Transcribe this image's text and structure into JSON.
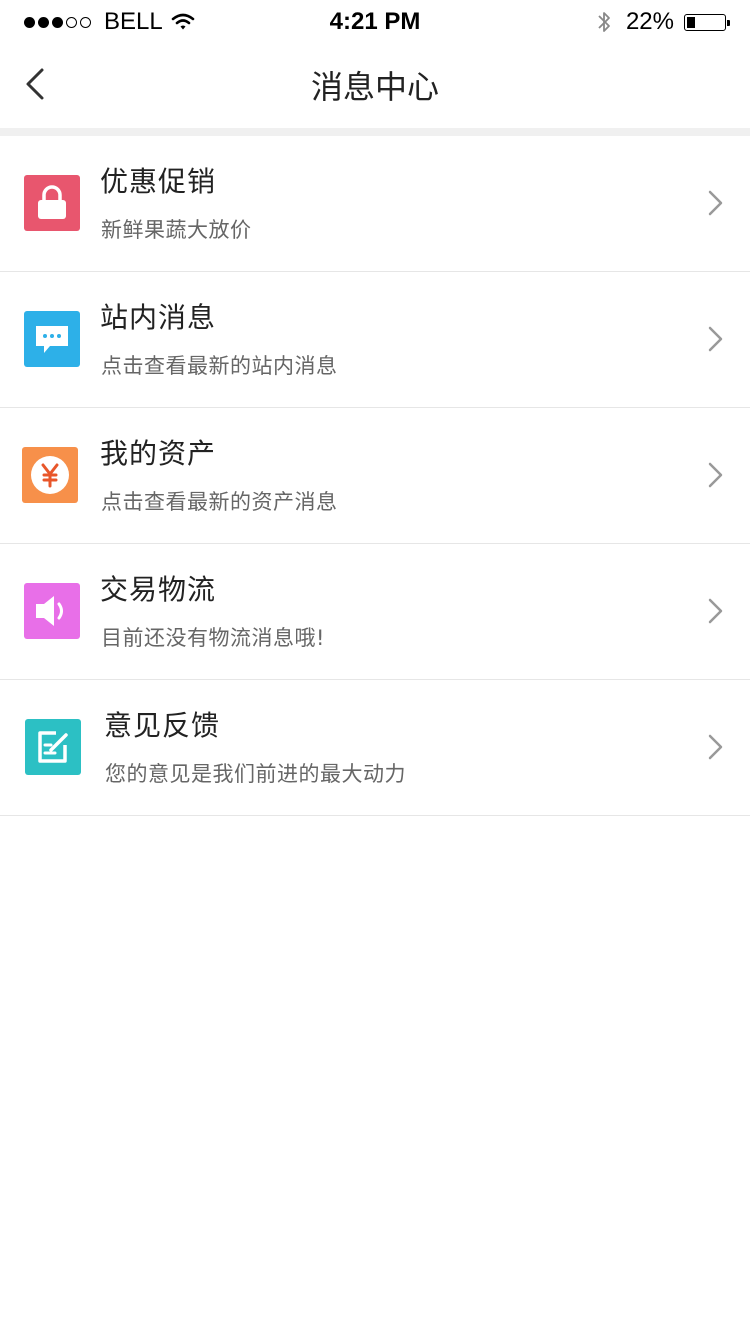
{
  "status_bar": {
    "carrier": "BELL",
    "time": "4:21 PM",
    "battery_percent": "22%",
    "battery_level": 0.22,
    "signal_bars_filled": 3,
    "signal_bars_total": 5,
    "icons": [
      "signal-icon",
      "wifi-icon",
      "bluetooth-icon",
      "battery-icon"
    ]
  },
  "nav": {
    "title": "消息中心",
    "back_icon": "chevron-left-icon"
  },
  "items": [
    {
      "title": "优惠促销",
      "subtitle": "新鲜果蔬大放价",
      "icon": "lock-icon",
      "color": "#E8566E"
    },
    {
      "title": "站内消息",
      "subtitle": "点击查看最新的站内消息",
      "icon": "chat-bubble-icon",
      "color": "#2DB0E8"
    },
    {
      "title": "我的资产",
      "subtitle": "点击查看最新的资产消息",
      "icon": "yen-icon",
      "color": "#F7904A"
    },
    {
      "title": "交易物流",
      "subtitle": "目前还没有物流消息哦!",
      "icon": "speaker-icon",
      "color": "#E86FE8"
    },
    {
      "title": "意见反馈",
      "subtitle": "您的意见是我们前进的最大动力",
      "icon": "edit-note-icon",
      "color": "#2CC0C4"
    }
  ]
}
